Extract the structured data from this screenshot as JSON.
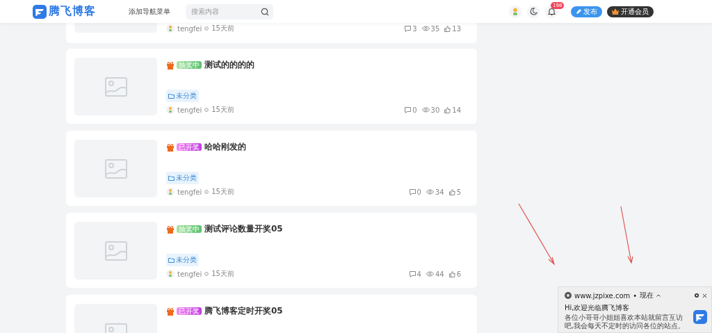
{
  "header": {
    "logo_text": "腾飞博客",
    "nav": [
      {
        "label": "添加导航菜单"
      }
    ],
    "search": {
      "placeholder": "搜索内容"
    },
    "notification_count": "198",
    "publish_button": "发布",
    "vip_button": "开通会员"
  },
  "posts": [
    {
      "author": "tengfei",
      "time": "15天前",
      "comments": "3",
      "views": "35",
      "likes": "13"
    },
    {
      "status": {
        "kind": "ongoing",
        "label": "抽奖中"
      },
      "title": "测试的的的的",
      "category": "未分类",
      "author": "tengfei",
      "time": "15天前",
      "comments": "0",
      "views": "30",
      "likes": "14"
    },
    {
      "status": {
        "kind": "ended",
        "label": "已开奖"
      },
      "title": "哈哈刚发的",
      "category": "未分类",
      "author": "tengfei",
      "time": "15天前",
      "comments": "0",
      "views": "34",
      "likes": "5"
    },
    {
      "status": {
        "kind": "ongoing",
        "label": "抽奖中"
      },
      "title": "测试评论数量开奖05",
      "category": "未分类",
      "author": "tengfei",
      "time": "15天前",
      "comments": "4",
      "views": "44",
      "likes": "6"
    },
    {
      "status": {
        "kind": "ended",
        "label": "已开奖"
      },
      "title": "腾飞博客定时开奖05"
    }
  ],
  "toast": {
    "site": "www.jzpixe.com",
    "separator": "•",
    "time": "现在",
    "title": "Hi,欢迎光临腾飞博客",
    "body": "各位小哥哥小姐姐喜欢本站就留言互访吧,我会每天不定时的访问各位的站点。"
  }
}
